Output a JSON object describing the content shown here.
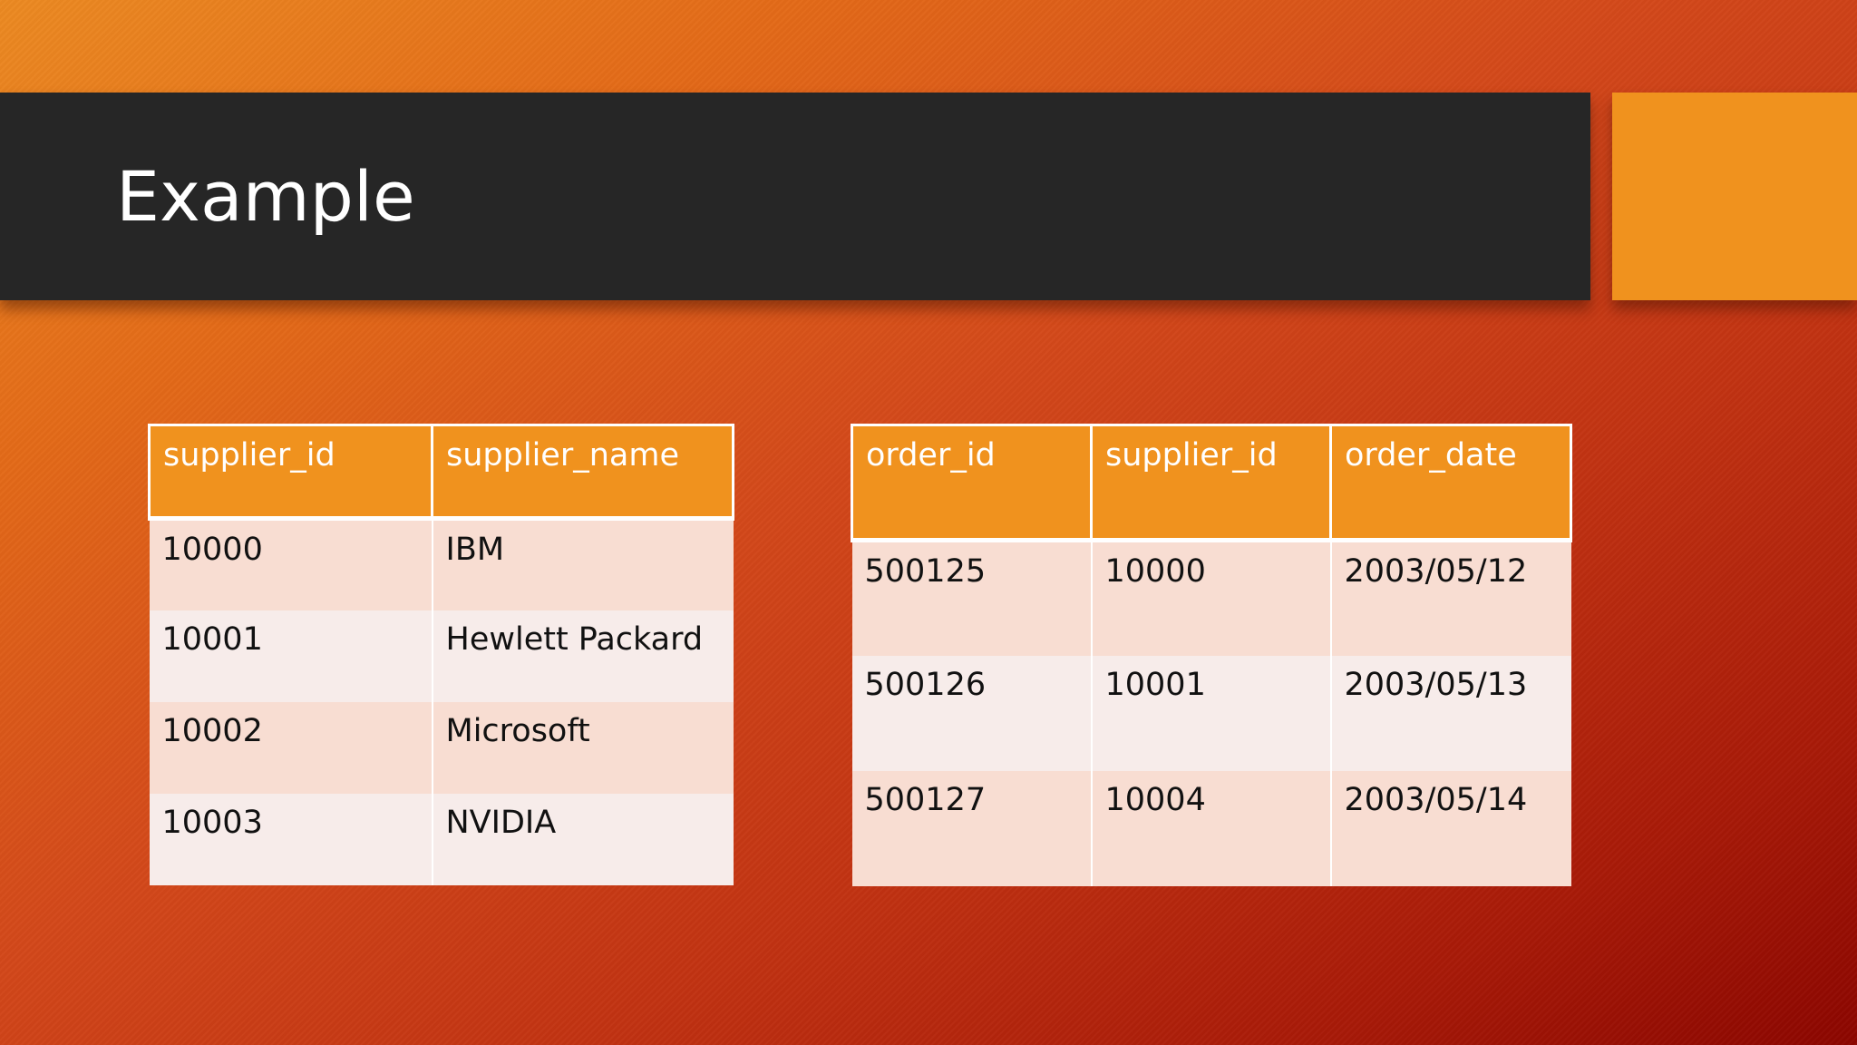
{
  "slide": {
    "title": "Example",
    "colors": {
      "title_bar": "#262626",
      "accent": "#f0921e",
      "header_fill": "#f0921e",
      "row_band_1": "#f8ddd2",
      "row_band_2": "#f7ecea",
      "background_light": "#ec8a22",
      "background_dark": "#8c0600"
    }
  },
  "suppliers_table": {
    "columns": [
      "supplier_id",
      "supplier_name"
    ],
    "rows": [
      [
        "10000",
        "IBM"
      ],
      [
        "10001",
        "Hewlett Packard"
      ],
      [
        "10002",
        "Microsoft"
      ],
      [
        "10003",
        "NVIDIA"
      ]
    ]
  },
  "orders_table": {
    "columns": [
      "order_id",
      "supplier_id",
      "order_date"
    ],
    "rows": [
      [
        "500125",
        "10000",
        "2003/05/12"
      ],
      [
        "500126",
        "10001",
        "2003/05/13"
      ],
      [
        "500127",
        "10004",
        "2003/05/14"
      ]
    ]
  }
}
